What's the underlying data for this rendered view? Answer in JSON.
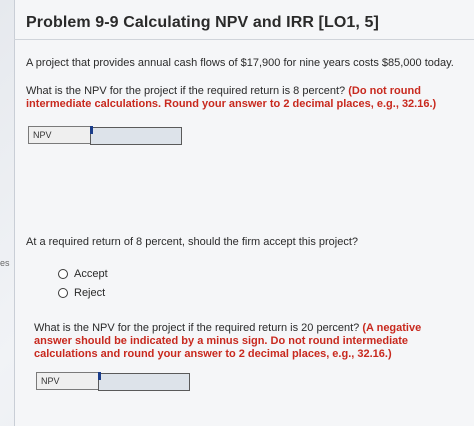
{
  "problem": {
    "title": "Problem 9-9 Calculating NPV and IRR [LO1, 5]",
    "intro": "A project that provides annual cash flows of $17,900 for nine years costs $85,000 today."
  },
  "question1": {
    "text": "What is the NPV for the project if the required return is 8 percent?",
    "instruction": "(Do not round intermediate calculations. Round your answer to 2 decimal places, e.g., 32.16.)",
    "answer_label": "NPV",
    "answer_value": ""
  },
  "question2": {
    "text": "At a required return of 8 percent, should the firm accept this project?",
    "options": [
      "Accept",
      "Reject"
    ]
  },
  "question3": {
    "text": "What is the NPV for the project if the required return is 20 percent?",
    "instruction": "(A negative answer should be indicated by a minus sign. Do not round intermediate calculations and round your answer to 2 decimal places, e.g., 32.16.)",
    "answer_label": "NPV",
    "answer_value": ""
  },
  "left_edge_text": "es",
  "colors": {
    "instruction_red": "#c8291e",
    "input_fill": "#dde3ea",
    "marker_blue": "#1b3d8a"
  }
}
